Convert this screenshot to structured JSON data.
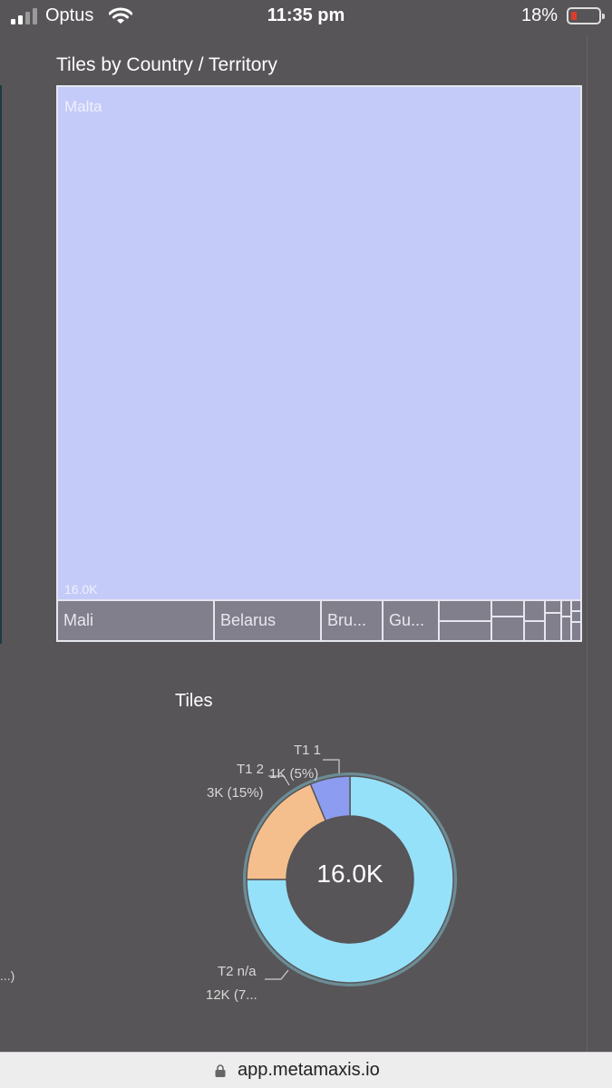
{
  "status_bar": {
    "carrier": "Optus",
    "time": "11:35 pm",
    "battery": "18%",
    "icons": [
      "signal-icon",
      "wifi-icon",
      "battery-icon"
    ]
  },
  "treemap": {
    "title": "Tiles by Country / Territory",
    "main_tile": {
      "label": "Malta",
      "value": "16.0K"
    },
    "small_tiles": [
      "Mali",
      "Belarus",
      "Bru...",
      "Gu..."
    ],
    "colors": {
      "main": "#c5cbf8",
      "others": "#817f8c"
    }
  },
  "donut": {
    "title": "Tiles",
    "center_value": "16.0K",
    "labels": {
      "t1_1_name": "T1 1",
      "t1_1_value": "1K (5%)",
      "t1_2_name": "T1 2",
      "t1_2_value": "3K (15%)",
      "t2_name": "T2 n/a",
      "t2_value": "12K (7..."
    }
  },
  "chart_data": [
    {
      "type": "treemap",
      "title": "Tiles by Country / Territory",
      "categories": [
        "Malta",
        "Mali",
        "Belarus",
        "Bru...",
        "Gu..."
      ],
      "values": [
        16000,
        null,
        null,
        null,
        null
      ]
    },
    {
      "type": "pie",
      "title": "Tiles",
      "categories": [
        "T2 n/a",
        "T1 2",
        "T1 1"
      ],
      "values": [
        12000,
        3000,
        1000
      ],
      "percent": [
        80,
        15,
        5
      ],
      "total": "16.0K",
      "colors": [
        "#96e1fa",
        "#f5bf8d",
        "#8c9cf0"
      ]
    }
  ],
  "left_edge_text": "...)",
  "url_bar": {
    "url": "app.metamaxis.io"
  }
}
